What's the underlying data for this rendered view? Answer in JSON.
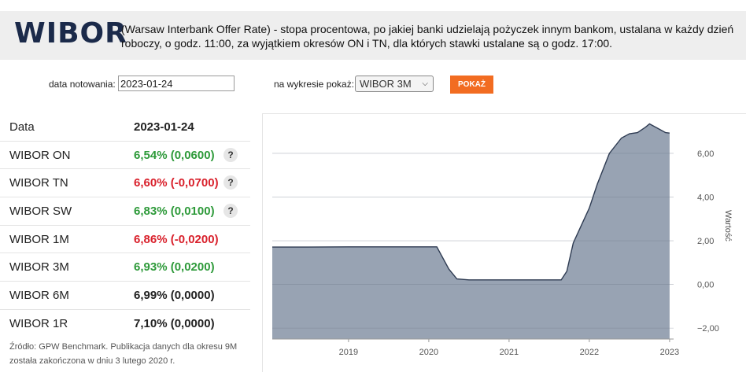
{
  "header": {
    "logo": "WIBOR",
    "description": "(Warsaw Interbank Offer Rate) - stopa procentowa, po jakiej banki udzielają pożyczek innym bankom, ustalana w każdy dzień roboczy, o godz. 11:00, za wyjątkiem okresów ON i TN, dla których stawki ustalane są o godz. 17:00."
  },
  "controls": {
    "date_label": "data notowania:",
    "date_value": "2023-01-24",
    "chart_label": "na wykresie pokaż:",
    "chart_selected": "WIBOR 3M",
    "show_button": "POKAŻ"
  },
  "table": {
    "header_name": "Data",
    "header_value": "2023-01-24",
    "rows": [
      {
        "name": "WIBOR ON",
        "value": "6,54% (0,0600)",
        "trend": "up",
        "help": "?"
      },
      {
        "name": "WIBOR TN",
        "value": "6,60% (-0,0700)",
        "trend": "down",
        "help": "?"
      },
      {
        "name": "WIBOR SW",
        "value": "6,83% (0,0100)",
        "trend": "up",
        "help": "?"
      },
      {
        "name": "WIBOR 1M",
        "value": "6,86% (-0,0200)",
        "trend": "down"
      },
      {
        "name": "WIBOR 3M",
        "value": "6,93% (0,0200)",
        "trend": "up"
      },
      {
        "name": "WIBOR 6M",
        "value": "6,99% (0,0000)",
        "trend": "flat"
      },
      {
        "name": "WIBOR 1R",
        "value": "7,10% (0,0000)",
        "trend": "flat"
      }
    ]
  },
  "source_note": "Źródło: GPW Benchmark. Publikacja danych dla okresu 9M została zakończona w dniu 3 lutego 2020 r.",
  "colors": {
    "accent": "#f26c21",
    "positive": "#2e9a3a",
    "negative": "#d9212c",
    "area_fill": "#98a3b3",
    "line": "#2e3b52"
  },
  "chart_data": {
    "type": "area",
    "ylabel": "Wartość",
    "ylim": [
      -2.5,
      7.8
    ],
    "yticks": [
      "6,00",
      "4,00",
      "2,00",
      "0,00",
      "−2,00"
    ],
    "ytick_values": [
      6,
      4,
      2,
      0,
      -2
    ],
    "xticks": [
      "2019",
      "2020",
      "2021",
      "2022",
      "2023"
    ],
    "xtick_values": [
      2019,
      2020,
      2021,
      2022,
      2023
    ],
    "xlim": [
      2018.05,
      2023.05
    ],
    "grid": true,
    "series": [
      {
        "x": [
          2018.05,
          2018.5,
          2019.0,
          2019.5,
          2020.0,
          2020.1,
          2020.25,
          2020.35,
          2020.5,
          2020.75,
          2021.0,
          2021.25,
          2021.5,
          2021.65,
          2021.72,
          2021.8,
          2021.9,
          2022.0,
          2022.1,
          2022.25,
          2022.4,
          2022.5,
          2022.6,
          2022.7,
          2022.75,
          2022.85,
          2022.95,
          2023.0
        ],
        "y": [
          1.71,
          1.71,
          1.72,
          1.72,
          1.72,
          1.72,
          0.7,
          0.25,
          0.21,
          0.21,
          0.21,
          0.21,
          0.21,
          0.21,
          0.6,
          1.9,
          2.7,
          3.5,
          4.6,
          6.0,
          6.7,
          6.9,
          6.95,
          7.2,
          7.35,
          7.15,
          6.95,
          6.93
        ]
      }
    ]
  }
}
